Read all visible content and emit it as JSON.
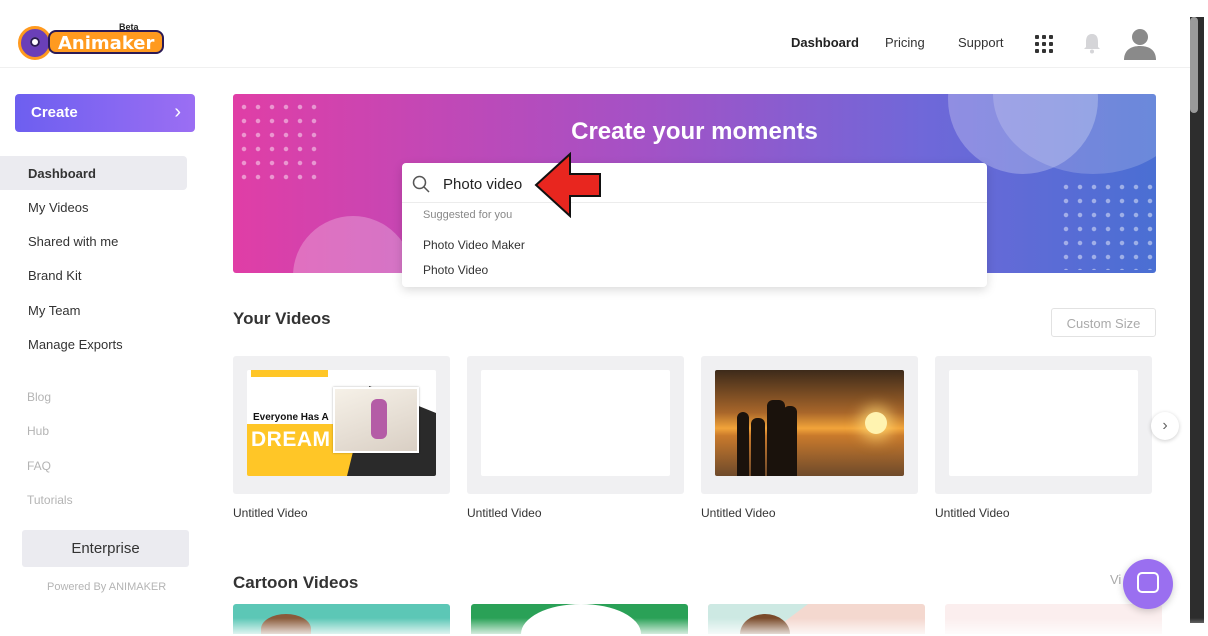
{
  "brand": {
    "name": "Animaker",
    "beta": "Beta"
  },
  "header": {
    "nav": [
      "Dashboard",
      "Pricing",
      "Support"
    ]
  },
  "sidebar": {
    "create_label": "Create",
    "items": [
      "Dashboard",
      "My Videos",
      "Shared with me",
      "Brand Kit",
      "My Team",
      "Manage Exports"
    ],
    "links": [
      "Blog",
      "Hub",
      "FAQ",
      "Tutorials"
    ],
    "enterprise_label": "Enterprise",
    "powered_by": "Powered By ANIMAKER"
  },
  "hero": {
    "title": "Create your moments"
  },
  "search": {
    "value": "Photo video",
    "suggested_heading": "Suggested for you",
    "suggestions": [
      "Photo Video Maker",
      "Photo Video"
    ]
  },
  "your_videos": {
    "title": "Your Videos",
    "custom_size_label": "Custom Size",
    "items": [
      "Untitled Video",
      "Untitled Video",
      "Untitled Video",
      "Untitled Video"
    ],
    "thumb_text": {
      "line1": "Everyone Has A",
      "line2": "DREAM"
    }
  },
  "cartoon_videos": {
    "title": "Cartoon Videos",
    "view_all_partial": "Vi"
  },
  "colors": {
    "accent": "#7a63f1",
    "hero_start": "#e03ea6",
    "hero_end": "#4a6fd3",
    "arrow": "#e8261f"
  }
}
